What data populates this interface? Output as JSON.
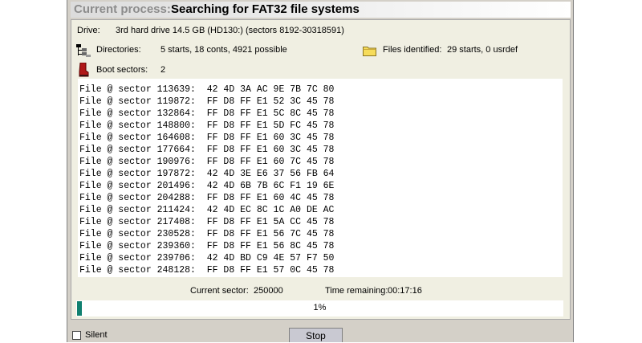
{
  "title": {
    "label": "Current process:",
    "value": "Searching for FAT32 file systems"
  },
  "drive": {
    "label": "Drive:",
    "value": "3rd hard drive 14.5 GB (HD130:) (sectors 8192-30318591)"
  },
  "directories": {
    "label": "Directories:",
    "value": "5 starts, 18 conts, 4921 possible",
    "icon": "directory-tree-icon"
  },
  "files_identified": {
    "label": "Files identified:",
    "value": "29 starts, 0 usrdef",
    "icon": "folder-icon"
  },
  "boot_sectors": {
    "label": "Boot sectors:",
    "value": "2",
    "icon": "boot-icon"
  },
  "log_lines": [
    "File @ sector 113639:  42 4D 3A AC 9E 7B 7C 80",
    "File @ sector 119872:  FF D8 FF E1 52 3C 45 78",
    "File @ sector 132864:  FF D8 FF E1 5C 8C 45 78",
    "File @ sector 148800:  FF D8 FF E1 5D FC 45 78",
    "File @ sector 164608:  FF D8 FF E1 60 3C 45 78",
    "File @ sector 177664:  FF D8 FF E1 60 3C 45 78",
    "File @ sector 190976:  FF D8 FF E1 60 7C 45 78",
    "File @ sector 197872:  42 4D 3E E6 37 56 FB 64",
    "File @ sector 201496:  42 4D 6B 7B 6C F1 19 6E",
    "File @ sector 204288:  FF D8 FF E1 60 4C 45 78",
    "File @ sector 211424:  42 4D EC 8C 1C A0 DE AC",
    "File @ sector 217408:  FF D8 FF E1 5A CC 45 78",
    "File @ sector 230528:  FF D8 FF E1 56 7C 45 78",
    "File @ sector 239360:  FF D8 FF E1 56 8C 45 78",
    "File @ sector 239706:  42 4D BD C9 4E 57 F7 50",
    "File @ sector 248128:  FF D8 FF E1 57 0C 45 78"
  ],
  "current_sector": {
    "label": "Current sector:",
    "value": "250000"
  },
  "time_remaining": {
    "label": "Time remaining:",
    "value": "00:17:16"
  },
  "progress": {
    "percent": 1,
    "label": "1%",
    "color": "#108070"
  },
  "silent": {
    "label": "Silent",
    "checked": false
  },
  "stop_label": "Stop"
}
